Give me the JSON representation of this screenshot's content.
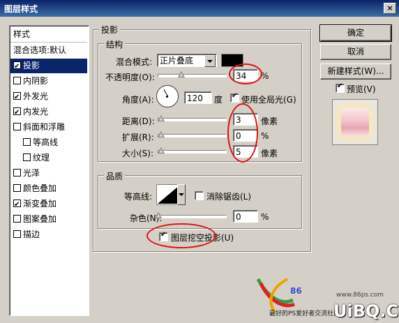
{
  "window": {
    "title": "图层样式",
    "close": "×"
  },
  "styles_list": {
    "header": "样式",
    "blend_options": "混合选项:默认",
    "items": [
      {
        "label": "投影",
        "checked": true,
        "selected": true
      },
      {
        "label": "内阴影",
        "checked": false
      },
      {
        "label": "外发光",
        "checked": true
      },
      {
        "label": "内发光",
        "checked": true
      },
      {
        "label": "斜面和浮雕",
        "checked": false
      },
      {
        "label": "等高线",
        "checked": false,
        "indent": true
      },
      {
        "label": "纹理",
        "checked": false,
        "indent": true
      },
      {
        "label": "光泽",
        "checked": false
      },
      {
        "label": "颜色叠加",
        "checked": false
      },
      {
        "label": "渐变叠加",
        "checked": true
      },
      {
        "label": "图案叠加",
        "checked": false
      },
      {
        "label": "描边",
        "checked": false
      }
    ]
  },
  "shadow_panel": {
    "title": "投影",
    "structure": {
      "title": "结构",
      "blend_mode_label": "混合模式:",
      "blend_mode_value": "正片叠底",
      "blend_color": "#000000",
      "opacity_label": "不透明度(O):",
      "opacity_value": "34",
      "opacity_unit": "%",
      "angle_label": "角度(A):",
      "angle_value": "120",
      "angle_unit": "度",
      "global_light_label": "使用全局光(G)",
      "global_light_checked": true,
      "distance_label": "距离(D):",
      "distance_value": "3",
      "distance_unit": "像素",
      "spread_label": "扩展(R):",
      "spread_value": "0",
      "spread_unit": "%",
      "size_label": "大小(S):",
      "size_value": "5",
      "size_unit": "像素"
    },
    "quality": {
      "title": "品质",
      "contour_label": "等高线:",
      "antialias_label": "消除锯齿(L)",
      "antialias_checked": false,
      "noise_label": "杂色(N):",
      "noise_value": "0",
      "noise_unit": "%"
    },
    "knockout_label": "图层挖空投影(U)",
    "knockout_checked": true
  },
  "buttons": {
    "ok": "确定",
    "cancel": "取消",
    "new_style": "新建样式(W)...",
    "preview_label": "预览(V)",
    "preview_checked": true
  },
  "annotation_color": "#e01010",
  "watermark": {
    "site": "www.86ps.com",
    "logo_text": "86",
    "brand": "UiBQ.CoM",
    "tagline": "最好的PS爱好者交流社区"
  }
}
